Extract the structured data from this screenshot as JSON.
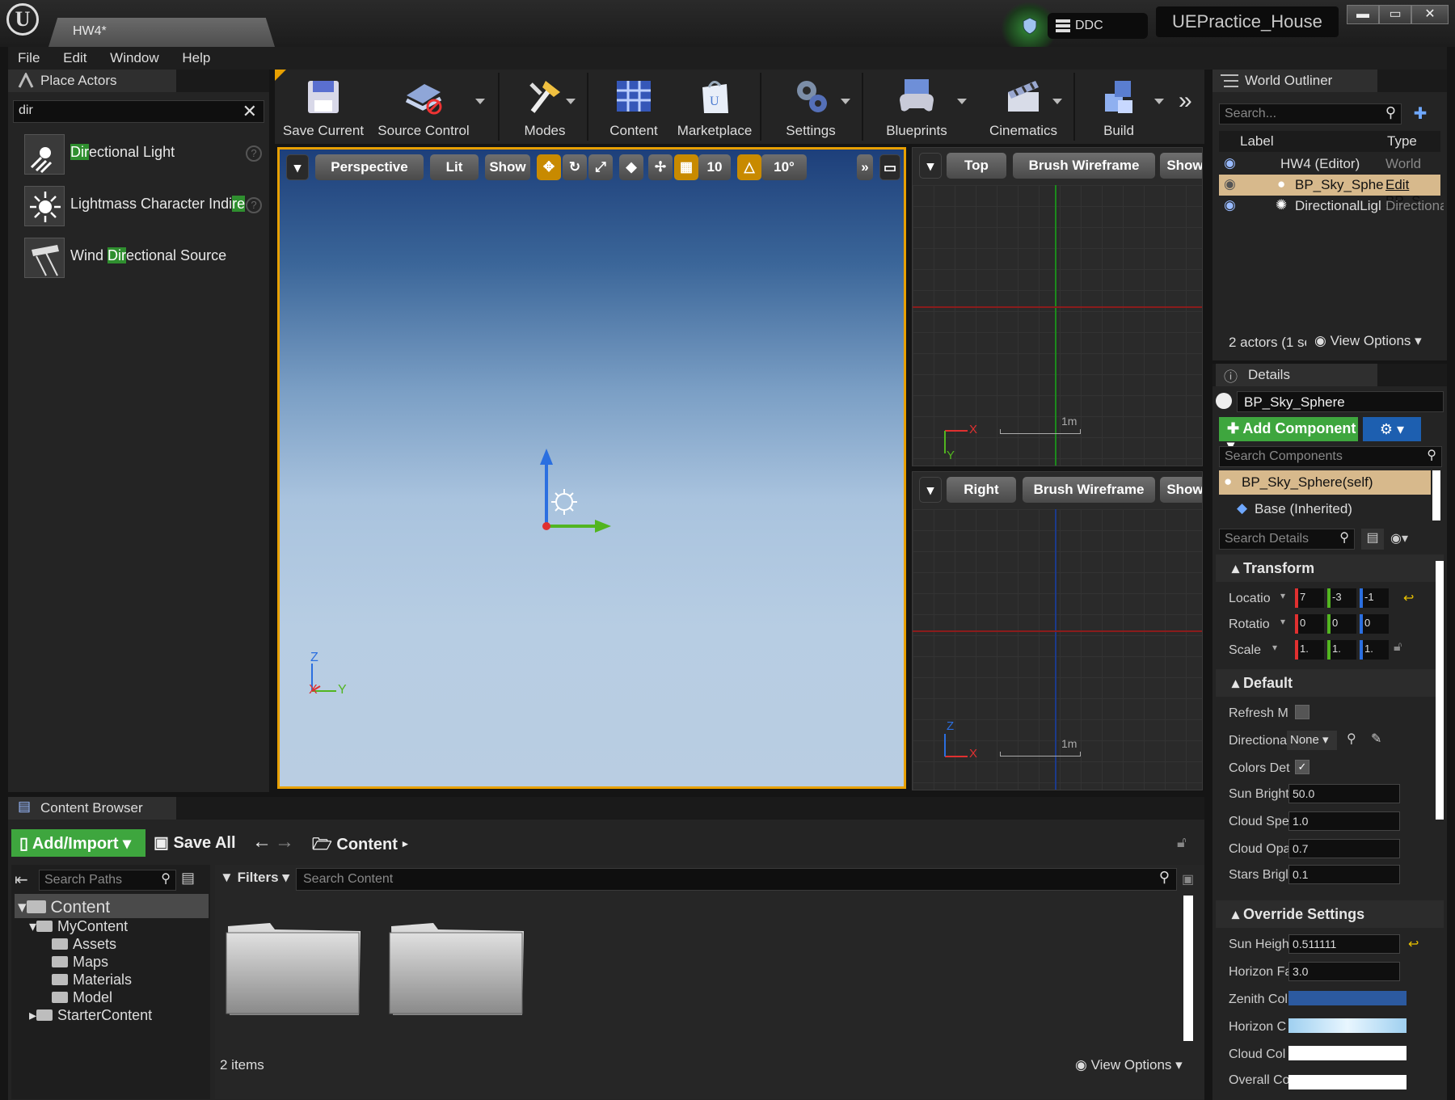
{
  "window": {
    "tab_title": "HW4*",
    "project": "UEPractice_House",
    "ddc": "DDC",
    "minimize": "▬",
    "maximize": "▭",
    "close": "✕"
  },
  "menu": [
    "File",
    "Edit",
    "Window",
    "Help"
  ],
  "place_actors": {
    "tab": "Place Actors",
    "search_value": "dir",
    "items": [
      {
        "pre": "",
        "hl": "Dir",
        "post": "ectional Light"
      },
      {
        "pre": "Lightmass Character Indi",
        "hl": "re",
        "post": ""
      },
      {
        "pre": "Wind ",
        "hl": "Dir",
        "post": "ectional Source"
      }
    ]
  },
  "toolbar": {
    "save_current": "Save Current",
    "source_control": "Source Control",
    "modes": "Modes",
    "content": "Content",
    "marketplace": "Marketplace",
    "settings": "Settings",
    "blueprints": "Blueprints",
    "cinematics": "Cinematics",
    "build": "Build"
  },
  "viewport_perspective": {
    "perspective": "Perspective",
    "lit": "Lit",
    "show": "Show",
    "grid_snap": "10",
    "rot_snap": "10°",
    "axis_z": "Z",
    "axis_x": "X",
    "axis_y": "Y"
  },
  "viewport_top": {
    "view": "Top",
    "mode": "Brush Wireframe",
    "show": "Show",
    "scale": "1m",
    "axis_x": "X",
    "axis_y": "Y"
  },
  "viewport_right": {
    "view": "Right",
    "mode": "Brush Wireframe",
    "show": "Show",
    "scale": "1m",
    "axis_x": "X",
    "axis_z": "Z"
  },
  "world_outliner": {
    "tab": "World Outliner",
    "search_placeholder": "Search...",
    "col_label": "Label",
    "col_type": "Type",
    "rows": [
      {
        "label": "HW4 (Editor)",
        "type": "World"
      },
      {
        "label": "BP_Sky_Spher",
        "type": "Edit BP_S"
      },
      {
        "label": "DirectionalLigl",
        "type": "Directiona"
      }
    ],
    "status": "2 actors (1 se",
    "view_options": "View Options"
  },
  "details": {
    "tab": "Details",
    "name": "BP_Sky_Sphere",
    "add_component": "Add Component",
    "search_components": "Search Components",
    "self_component": "BP_Sky_Sphere(self)",
    "base_component": "Base (Inherited)",
    "search_details": "Search Details",
    "transform_header": "Transform",
    "location": "Locatio",
    "rotation": "Rotatio",
    "scale": "Scale",
    "loc_vals": [
      "7",
      "-3",
      "-1"
    ],
    "rot_vals": [
      "0",
      "0",
      "0"
    ],
    "scale_vals": [
      "1.",
      "1.",
      "1."
    ],
    "default_header": "Default",
    "refresh": "Refresh M",
    "directional": "Directiona",
    "directional_value": "None",
    "colors": "Colors Det",
    "sun_bright": "Sun Bright",
    "sun_bright_val": "50.0",
    "cloud_speed": "Cloud Spe",
    "cloud_speed_val": "1.0",
    "cloud_opacity": "Cloud Opa",
    "cloud_opacity_val": "0.7",
    "stars_bright": "Stars Brigl",
    "stars_bright_val": "0.1",
    "override_header": "Override Settings",
    "sun_height": "Sun Heigh",
    "sun_height_val": "0.511111",
    "horizon_falloff": "Horizon Fa",
    "horizon_falloff_val": "3.0",
    "zenith_color": "Zenith Col",
    "horizon_color": "Horizon C",
    "cloud_color": "Cloud Col",
    "overall_color": "Overall Co",
    "colors_swatch": {
      "zenith": "#2c5aa0",
      "horizon": "#9fd0f0",
      "cloud": "#ffffff"
    }
  },
  "content_browser": {
    "tab": "Content Browser",
    "add_import": "Add/Import",
    "save_all": "Save All",
    "path": "Content",
    "search_paths": "Search Paths",
    "filters": "Filters",
    "search_content": "Search Content",
    "tree": [
      "Content",
      "MyContent",
      "Assets",
      "Maps",
      "Materials",
      "Model",
      "StarterContent"
    ],
    "items_count": "2 items",
    "view_options": "View Options"
  },
  "colors": {
    "accent": "#e8a000",
    "green": "#3ea63e",
    "blue": "#1d5fb0"
  }
}
